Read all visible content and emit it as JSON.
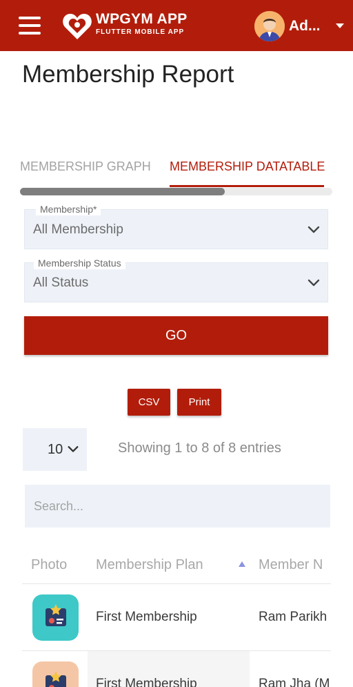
{
  "app": {
    "name": "WPGYM APP",
    "subtitle": "FLUTTER MOBILE APP",
    "user_name": "Ad...",
    "brand_color": "#b21d0b"
  },
  "icons": {
    "menu": "hamburger-menu-icon",
    "logo": "heart-logo-icon",
    "user_caret": "caret-down-icon",
    "dropdown": "chevron-down-icon",
    "sort": "sort-ascending-icon",
    "membership_card": "membership-card-icon"
  },
  "page": {
    "title": "Membership Report"
  },
  "tabs": [
    {
      "label": "MEMBERSHIP GRAPH",
      "active": false
    },
    {
      "label": "MEMBERSHIP DATATABLE",
      "active": true
    }
  ],
  "filters": {
    "membership": {
      "label": "Membership*",
      "value": "All Membership"
    },
    "status": {
      "label": "Membership Status",
      "value": "All Status"
    },
    "go_label": "GO"
  },
  "export": {
    "csv_label": "CSV",
    "print_label": "Print"
  },
  "table_controls": {
    "page_length": "10",
    "info": "Showing 1 to 8 of 8 entries",
    "search_placeholder": "Search..."
  },
  "table": {
    "columns": [
      "Photo",
      "Membership Plan",
      "Member N"
    ],
    "rows": [
      {
        "plan": "First Membership",
        "member": "Ram Parikh",
        "photo_color": "#3ec8c8"
      },
      {
        "plan": "First Membership",
        "member": "Ram Jha (M",
        "photo_color": "#f5c6a6"
      }
    ]
  }
}
